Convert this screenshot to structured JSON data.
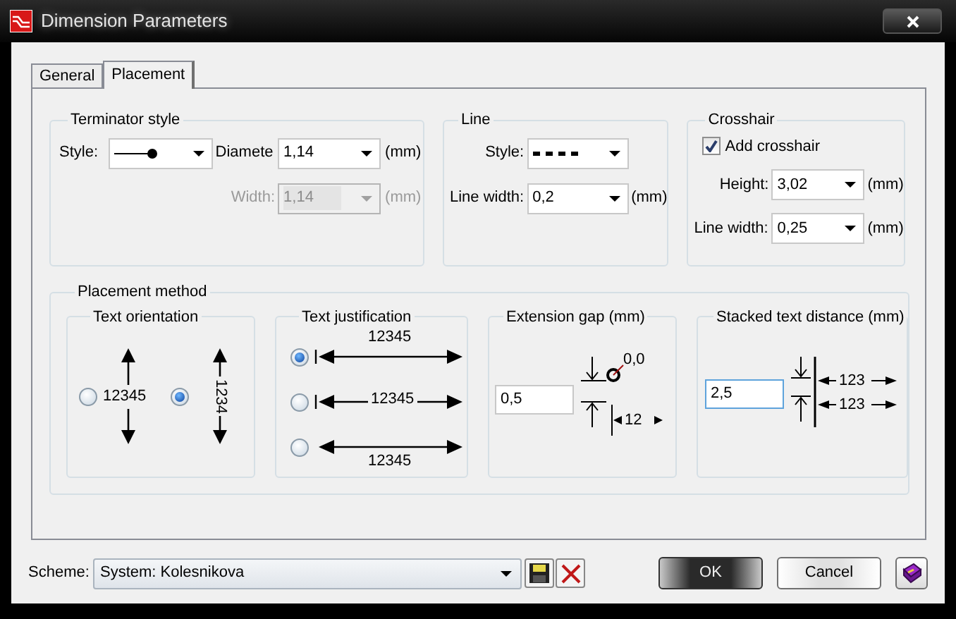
{
  "window": {
    "title": "Dimension Parameters"
  },
  "tabs": [
    {
      "label": "General",
      "selected": false
    },
    {
      "label": "Placement",
      "selected": true
    }
  ],
  "terminator_style": {
    "title": "Terminator style",
    "style_label": "Style:",
    "diameter_label": "Diamete",
    "diameter_value": "1,14",
    "diameter_unit": "(mm)",
    "width_label": "Width:",
    "width_value": "1,14",
    "width_unit": "(mm)",
    "width_disabled": true
  },
  "line": {
    "title": "Line",
    "style_label": "Style:",
    "width_label": "Line width:",
    "width_value": "0,2",
    "width_unit": "(mm)"
  },
  "crosshair": {
    "title": "Crosshair",
    "checkbox": {
      "label": "Add crosshair",
      "checked": true
    },
    "height_label": "Height:",
    "height_value": "3,02",
    "height_unit": "(mm)",
    "width_label": "Line width:",
    "width_value": "0,25",
    "width_unit": "(mm)"
  },
  "placement_method": {
    "title": "Placement method",
    "text_orientation": {
      "title": "Text orientation",
      "options": [
        {
          "kind": "horizontal",
          "label": "12345",
          "selected": false
        },
        {
          "kind": "vertical",
          "label": "1234",
          "selected": true
        }
      ]
    },
    "text_justification": {
      "title": "Text justification",
      "options": [
        {
          "kind": "above",
          "label": "12345",
          "selected": true
        },
        {
          "kind": "inline",
          "label": "12345",
          "selected": false
        },
        {
          "kind": "below",
          "label": "12345",
          "selected": false
        }
      ]
    },
    "extension_gap": {
      "title": "Extension gap (mm)",
      "value": "0,5",
      "focused": false,
      "diagram_labels": [
        "0,0",
        "12"
      ]
    },
    "stacked_text_distance": {
      "title": "Stacked text distance (mm)",
      "value": "2,5",
      "focused": true,
      "diagram_labels": [
        "123",
        "123"
      ]
    }
  },
  "scheme": {
    "label": "Scheme:",
    "value": "System: Kolesnikova"
  },
  "buttons": [
    {
      "label": "OK",
      "default": true
    },
    {
      "label": "Cancel",
      "default": false
    }
  ]
}
